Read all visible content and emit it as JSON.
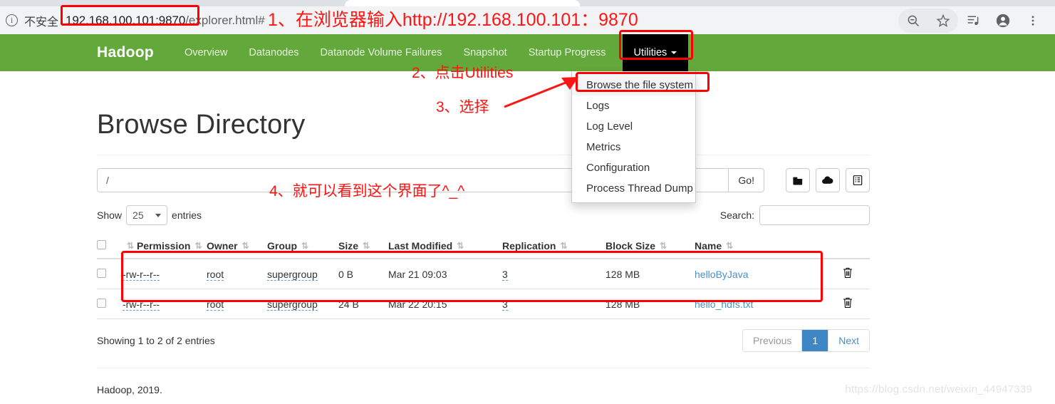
{
  "browser": {
    "security_label": "不安全",
    "url_highlighted": "192.168.100.101:9870",
    "url_rest": "/explorer.html#",
    "icons": {
      "info": "info-icon",
      "zoom_out": "zoom-out-icon",
      "bookmark": "star-icon",
      "media": "media-control-icon",
      "profile": "profile-avatar-icon",
      "menu": "three-dot-menu-icon"
    }
  },
  "navbar": {
    "brand": "Hadoop",
    "links": [
      "Overview",
      "Datanodes",
      "Datanode Volume Failures",
      "Snapshot",
      "Startup Progress"
    ],
    "utilities_label": "Utilities",
    "active_color": "#000000",
    "bar_color": "#63a83a"
  },
  "dropdown": {
    "items": [
      "Browse the file system",
      "Logs",
      "Log Level",
      "Metrics",
      "Configuration",
      "Process Thread Dump"
    ],
    "highlighted_index": 0
  },
  "main": {
    "title": "Browse Directory",
    "path_value": "/",
    "go_label": "Go!",
    "tool_buttons": [
      {
        "name": "new-directory-icon",
        "title": "Create directory"
      },
      {
        "name": "upload-file-icon",
        "title": "Upload files"
      },
      {
        "name": "cut-paste-icon",
        "title": "Cut / paste"
      }
    ],
    "show_label": "Show",
    "entries_label": "entries",
    "page_length": "25",
    "search_label": "Search:",
    "search_value": "",
    "columns": [
      "Permission",
      "Owner",
      "Group",
      "Size",
      "Last Modified",
      "Replication",
      "Block Size",
      "Name"
    ],
    "rows": [
      {
        "permission": "-rw-r--r--",
        "owner": "root",
        "group": "supergroup",
        "size": "0 B",
        "last_modified": "Mar 21 09:03",
        "replication": "3",
        "block_size": "128 MB",
        "name": "helloByJava"
      },
      {
        "permission": "-rw-r--r--",
        "owner": "root",
        "group": "supergroup",
        "size": "24 B",
        "last_modified": "Mar 22 20:15",
        "replication": "3",
        "block_size": "128 MB",
        "name": "hello_hdfs.txt"
      }
    ],
    "showing_text": "Showing 1 to 2 of 2 entries",
    "pagination": {
      "previous": "Previous",
      "current": "1",
      "next": "Next",
      "active_color": "#3f87c4"
    },
    "copyright": "Hadoop, 2019."
  },
  "annotations": {
    "color": "#fe1414",
    "step1": "1、在浏览器输入http://192.168.100.101：9870",
    "step1_number": "1、",
    "step1_text": "在浏览器输入http://192.168.100.101：9870",
    "step2": "2、点击Utilities",
    "step3": "3、选择",
    "step4": "4、就可以看到这个界面了^_^"
  },
  "watermark": "https://blog.csdn.net/weixin_44947339"
}
